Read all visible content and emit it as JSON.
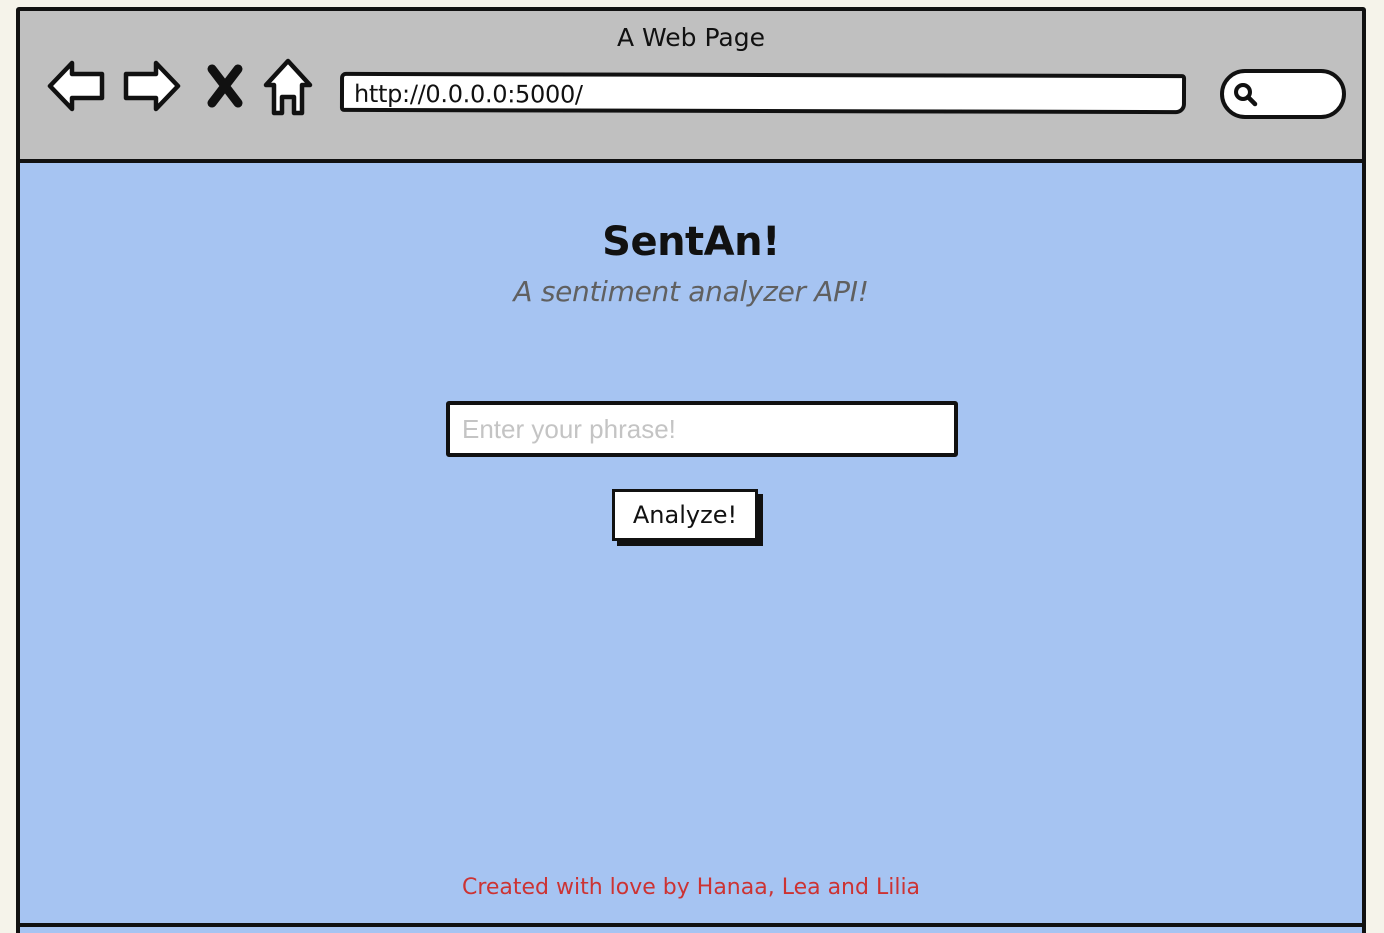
{
  "browser": {
    "window_title": "A Web Page",
    "address_url": "http://0.0.0.0:5000/",
    "icons": {
      "back": "back-arrow-icon",
      "forward": "forward-arrow-icon",
      "stop": "close-icon",
      "home": "home-icon",
      "search": "search-icon"
    }
  },
  "app": {
    "title": "SentAn!",
    "subtitle": "A sentiment analyzer API!",
    "input_placeholder": "Enter your phrase!",
    "input_value": "",
    "analyze_button_label": "Analyze!",
    "footer_text": "Created with love by Hanaa, Lea and Lilia"
  },
  "colors": {
    "page_background": "#a6c4f2",
    "chrome_background": "#c0c0c0",
    "footer_text": "#cc3333",
    "subtitle_text": "#606060"
  }
}
